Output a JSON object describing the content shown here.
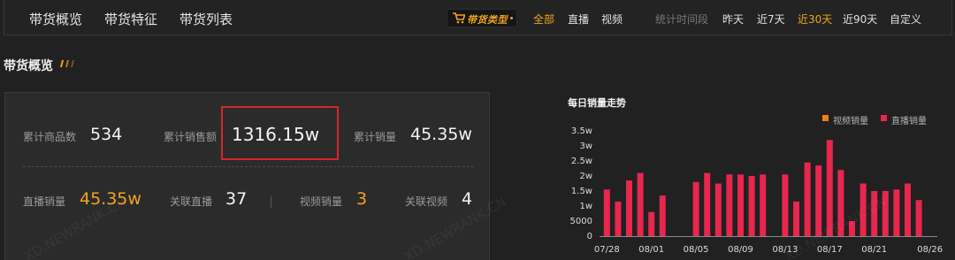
{
  "nav": {
    "tabs": [
      "带货概览",
      "带货特征",
      "带货列表"
    ],
    "type_badge": "带货类型",
    "type_filters": [
      {
        "label": "全部",
        "active": true
      },
      {
        "label": "直播",
        "active": false
      },
      {
        "label": "视频",
        "active": false
      }
    ],
    "period_label": "统计时间段",
    "periods": [
      {
        "label": "昨天",
        "active": false
      },
      {
        "label": "近7天",
        "active": false
      },
      {
        "label": "近30天",
        "active": true
      },
      {
        "label": "近90天",
        "active": false
      },
      {
        "label": "自定义",
        "active": false
      }
    ],
    "accent_color": "#f3a51b"
  },
  "overview": {
    "title": "带货概览",
    "metrics_row1": [
      {
        "label": "累计商品数",
        "value": "534"
      },
      {
        "label": "累计销售额",
        "value": "1316.15w"
      },
      {
        "label": "累计销量",
        "value": "45.35w"
      }
    ],
    "metrics_row2": [
      {
        "label": "直播销量",
        "value": "45.35w"
      },
      {
        "label": "关联直播",
        "value": "37"
      },
      {
        "label": "视频销量",
        "value": "3"
      },
      {
        "label": "关联视频",
        "value": "4"
      }
    ],
    "highlight_color": "#d7262a"
  },
  "watermark": "XD.NEWRANK.CN",
  "chart_data": {
    "type": "bar",
    "title": "每日销量走势",
    "legend_position": "top-right",
    "legend": [
      "视频销量",
      "直播销量"
    ],
    "grid": false,
    "y_tick_labels": [
      "3.5w",
      "3w",
      "2.5w",
      "2w",
      "1.5w",
      "1w",
      "5000",
      "0"
    ],
    "ylim": [
      0,
      35000
    ],
    "x_tick_labels": [
      "07/28",
      "08/01",
      "08/05",
      "08/09",
      "08/13",
      "08/17",
      "08/21",
      "08/26"
    ],
    "categories": [
      "07/28",
      "07/29",
      "07/30",
      "07/31",
      "08/01",
      "08/02",
      "08/03",
      "08/04",
      "08/05",
      "08/06",
      "08/07",
      "08/08",
      "08/09",
      "08/10",
      "08/11",
      "08/12",
      "08/13",
      "08/14",
      "08/15",
      "08/16",
      "08/17",
      "08/18",
      "08/19",
      "08/20",
      "08/21",
      "08/22",
      "08/23",
      "08/24",
      "08/25",
      "08/26"
    ],
    "series": [
      {
        "name": "视频销量",
        "color": "#f2800b",
        "values": [
          0,
          0,
          0,
          0,
          0,
          0,
          0,
          0,
          0,
          0,
          0,
          0,
          0,
          0,
          0,
          0,
          0,
          0,
          0,
          0,
          0,
          0,
          0,
          0,
          0,
          0,
          0,
          0,
          0,
          0
        ]
      },
      {
        "name": "直播销量",
        "color": "#e8264e",
        "values": [
          15500,
          11500,
          18500,
          21000,
          8000,
          13500,
          0,
          0,
          18000,
          21000,
          17500,
          20500,
          20500,
          20000,
          20500,
          0,
          20500,
          11500,
          24500,
          23500,
          32000,
          22000,
          5000,
          17500,
          15000,
          15000,
          15500,
          17500,
          12000,
          0
        ]
      }
    ]
  }
}
